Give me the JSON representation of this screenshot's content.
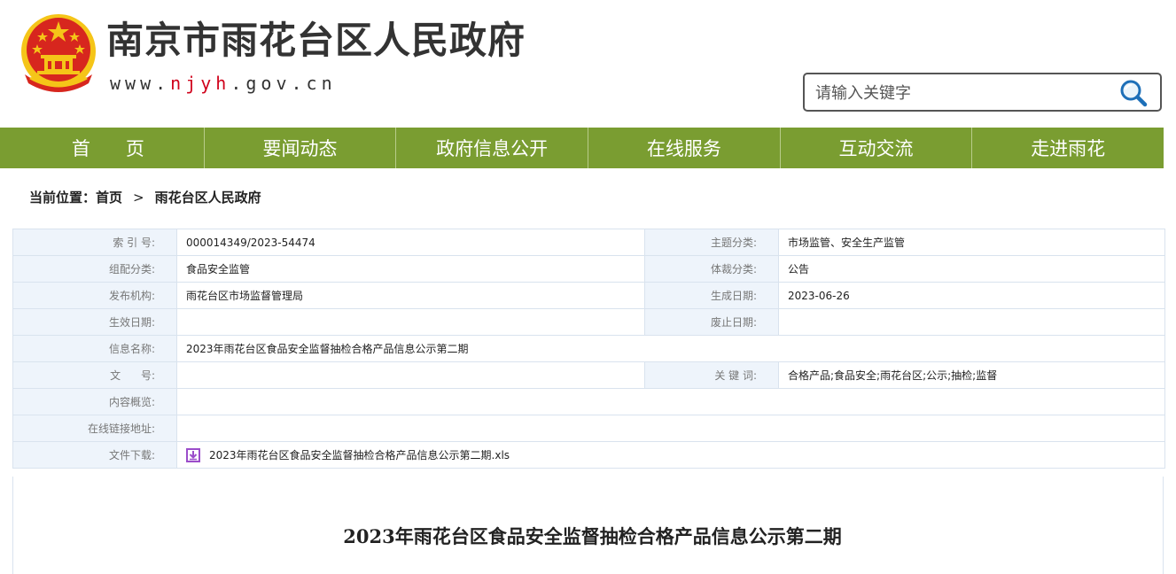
{
  "header": {
    "site_title": "南京市雨花台区人民政府",
    "site_url_prefix": "www.",
    "site_url_highlight": "njyh",
    "site_url_suffix": ".gov.cn",
    "search_placeholder": "请输入关键字"
  },
  "nav": {
    "items": [
      "首页",
      "要闻动态",
      "政府信息公开",
      "在线服务",
      "互动交流",
      "走进雨花"
    ]
  },
  "breadcrumb": {
    "prefix": "当前位置：",
    "home": "首页",
    "separator": ">",
    "current": "雨花台区人民政府"
  },
  "info": {
    "index_label": "索 引 号:",
    "index_value": "000014349/2023-54474",
    "topic_label": "主题分类:",
    "topic_value": "市场监管、安全生产监管",
    "category_label": "组配分类:",
    "category_value": "食品安全监管",
    "genre_label": "体裁分类:",
    "genre_value": "公告",
    "publisher_label": "发布机构:",
    "publisher_value": "雨花台区市场监督管理局",
    "created_label": "生成日期:",
    "created_value": "2023-06-26",
    "effective_label": "生效日期:",
    "effective_value": "",
    "abolished_label": "废止日期:",
    "abolished_value": "",
    "name_label": "信息名称:",
    "name_value": "2023年雨花台区食品安全监督抽检合格产品信息公示第二期",
    "docno_label": "文      号:",
    "docno_value": "",
    "keywords_label": "关 键 词:",
    "keywords_value": "合格产品;食品安全;雨花台区;公示;抽检;监督",
    "summary_label": "内容概览:",
    "summary_value": "",
    "link_label": "在线链接地址:",
    "link_value": "",
    "download_label": "文件下载:",
    "download_value": "2023年雨花台区食品安全监督抽检合格产品信息公示第二期.xls"
  },
  "article": {
    "title": "2023年雨花台区食品安全监督抽检合格产品信息公示第二期"
  },
  "colors": {
    "nav_bg": "#7a9d31",
    "label_bg": "#eef4fb",
    "url_highlight": "#d0021b",
    "emblem_red": "#d7261e",
    "emblem_gold": "#f5c518",
    "download_icon": "#9b4dca"
  }
}
